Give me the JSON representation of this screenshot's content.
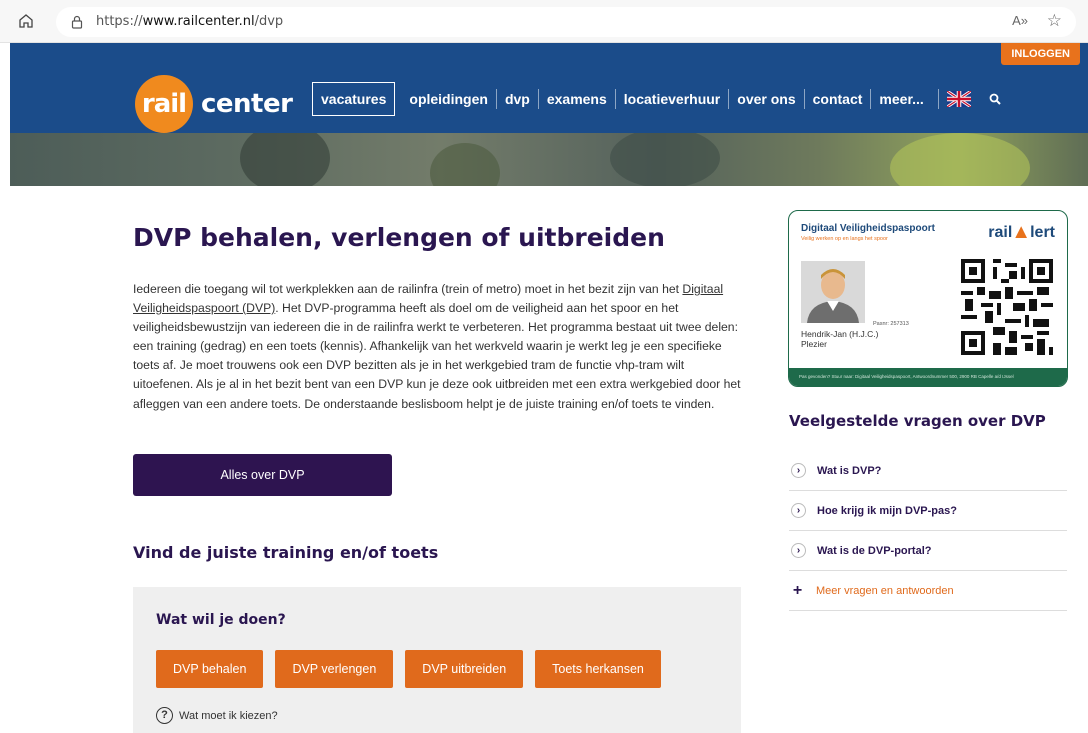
{
  "browser": {
    "url_prefix": "https://",
    "url_host": "www.railcenter.nl",
    "url_path": "/dvp",
    "read_aloud": "A»"
  },
  "header": {
    "login_label": "INLOGGEN",
    "logo_rail": "rail",
    "logo_center": "center",
    "nav": [
      "vacatures",
      "opleidingen",
      "dvp",
      "examens",
      "locatieverhuur",
      "over ons",
      "contact",
      "meer..."
    ]
  },
  "main": {
    "title": "DVP behalen, verlengen of uitbreiden",
    "intro_before_link": "Iedereen die toegang wil tot werkplekken aan de railinfra (trein of metro) moet in het bezit zijn van het ",
    "intro_link": "Digitaal Veiligheidspaspoort (DVP)",
    "intro_after_link": ". Het DVP-programma heeft als doel om de veiligheid aan het spoor en het veiligheidsbewustzijn van iedereen die in de railinfra werkt te verbeteren. Het programma bestaat uit twee delen: een training (gedrag) en een toets (kennis). Afhankelijk van het werkveld waarin je werkt leg je een specifieke toets af. Je moet trouwens ook een DVP bezitten als je in het werkgebied tram de functie vhp-tram wilt uitoefenen. Als je al in het bezit bent van een DVP kun je deze ook uitbreiden met een extra werkgebied door het afleggen van een andere toets. De onderstaande beslisboom helpt je de juiste training en/of toets te vinden.",
    "all_about_button": "Alles over DVP",
    "finder_title": "Vind de juiste training en/of toets",
    "question": "Wat wil je doen?",
    "choices": [
      "DVP behalen",
      "DVP verlengen",
      "DVP uitbreiden",
      "Toets herkansen"
    ],
    "help_label": "Wat moet ik kiezen?"
  },
  "card": {
    "title": "Digitaal Veiligheidspaspoort",
    "subtitle": "Veilig werken op en langs het spoor",
    "brand_left": "rail",
    "brand_right": "lert",
    "pas_nr": "Pasnr: 257313",
    "holder_line1": "Hendrik-Jan (H.J.C.)",
    "holder_line2": "Plezier",
    "footer": "Pas gevonden? Stuur naar: Digitaal Veiligheidspaspoort, Antwoordnummer 500, 2900 RB Capelle a/d IJssel"
  },
  "faq": {
    "title": "Veelgestelde vragen over DVP",
    "items": [
      "Wat is DVP?",
      "Hoe krijg ik mijn DVP-pas?",
      "Wat is de DVP-portal?"
    ],
    "more": "Meer vragen en antwoorden"
  },
  "colors": {
    "header_blue": "#1b4c8a",
    "accent_orange": "#e06a1c",
    "dark_purple": "#2e1450"
  }
}
